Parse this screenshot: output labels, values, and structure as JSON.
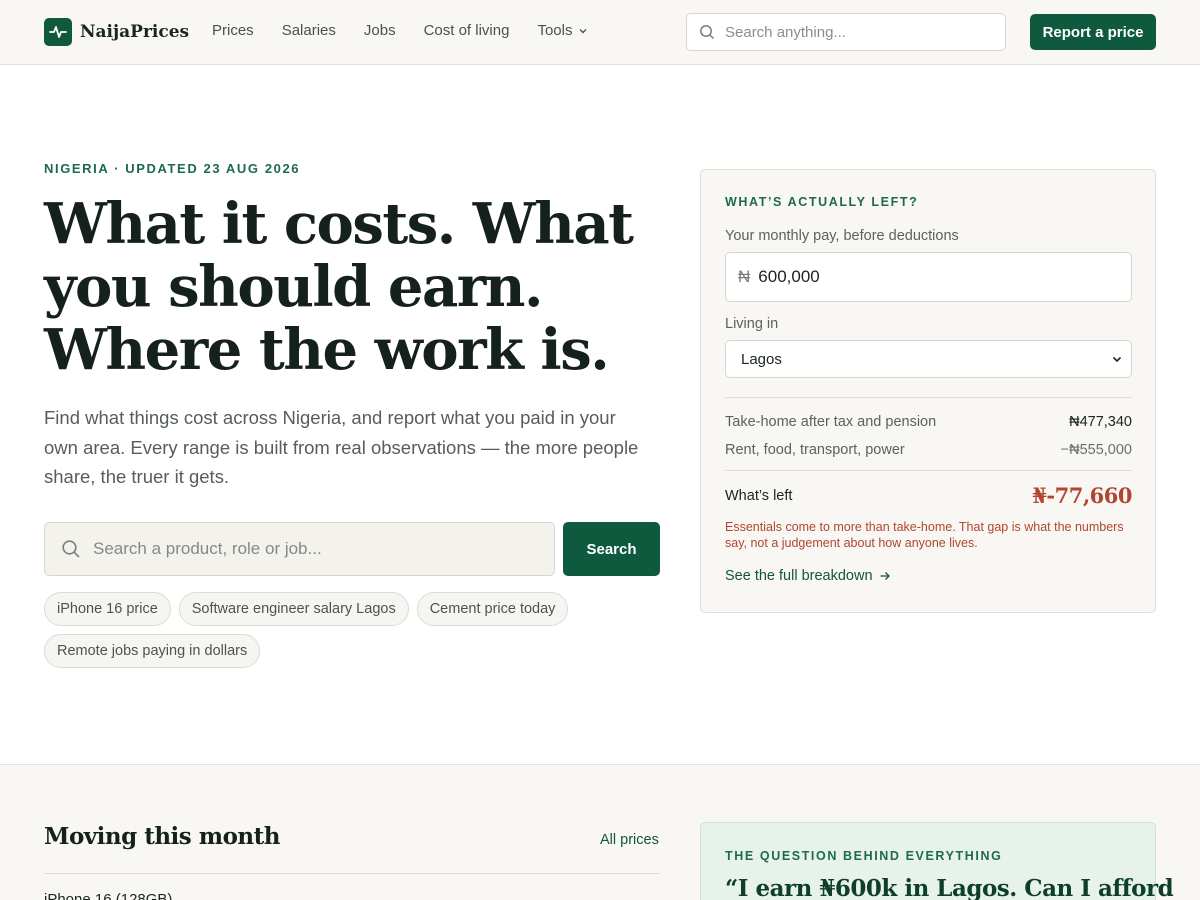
{
  "header": {
    "brand": "NaijaPrices",
    "nav": [
      "Prices",
      "Salaries",
      "Jobs",
      "Cost of living"
    ],
    "nav_tools": "Tools",
    "search_placeholder": "Search anything...",
    "report_button": "Report a price"
  },
  "hero": {
    "eyebrow": "NIGERIA · UPDATED 23 AUG 2026",
    "title_line1": "What it costs. What",
    "title_line2": "you should earn.",
    "title_line3": "Where the work is.",
    "subtitle": "Find what things cost across Nigeria, and report what you paid in your own area. Every range is built from real observations — the more people share, the truer it gets.",
    "search_placeholder": "Search a product, role or job...",
    "search_button": "Search",
    "chips": [
      "iPhone 16 price",
      "Software engineer salary Lagos",
      "Cement price today",
      "Remote jobs paying in dollars"
    ]
  },
  "calculator": {
    "eyebrow": "WHAT’S ACTUALLY LEFT?",
    "pay_label": "Your monthly pay, before deductions",
    "currency_symbol": "₦",
    "pay_value": "600,000",
    "city_label": "Living in",
    "city_value": "Lagos",
    "takehome_label": "Take-home after tax and pension",
    "takehome_value": "₦477,340",
    "essentials_label": "Rent, food, transport, power",
    "essentials_value": "−₦555,000",
    "left_label": "What’s left",
    "left_value": "₦-77,660",
    "note": "Essentials come to more than take-home. That gap is what the numbers say, not a judgement about how anyone lives.",
    "breakdown_link": "See the full breakdown"
  },
  "moving": {
    "title": "Moving this month",
    "all_link": "All prices",
    "first_item": "iPhone 16 (128GB)"
  },
  "question": {
    "eyebrow": "THE QUESTION BEHIND EVERYTHING",
    "quote": "“I earn ₦600k in Lagos. Can I afford"
  },
  "colors": {
    "brand_green": "#0f5a3e",
    "negative_red": "#b2452f",
    "page_bg": "#f8f7f3"
  }
}
